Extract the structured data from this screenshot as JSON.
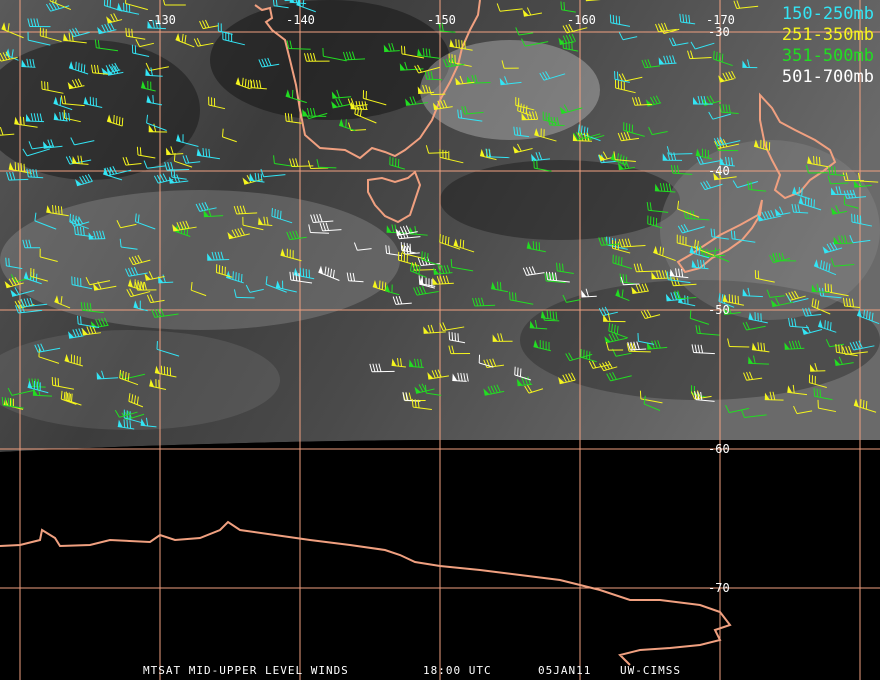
{
  "product": {
    "satellite_title": "MTSAT MID-UPPER LEVEL WINDS",
    "time": "18:00 UTC",
    "date": "05JAN11",
    "producer": "UW-CIMSS"
  },
  "legend": [
    {
      "label": "150-250mb",
      "color": "#33e5f5"
    },
    {
      "label": "251-350mb",
      "color": "#f5f51e"
    },
    {
      "label": "351-500mb",
      "color": "#22dd22"
    },
    {
      "label": "501-700mb",
      "color": "#ffffff"
    }
  ],
  "grid": {
    "longitude_labels": [
      "-130",
      "-140",
      "-150",
      "-160",
      "-170"
    ],
    "latitude_labels": [
      "-30",
      "-40",
      "-50",
      "-60",
      "-70"
    ],
    "line_color": "#f0a080"
  },
  "coast_color": "#f0a080",
  "image": {
    "kind": "water vapor imagery",
    "no_data_color": "#000000"
  }
}
